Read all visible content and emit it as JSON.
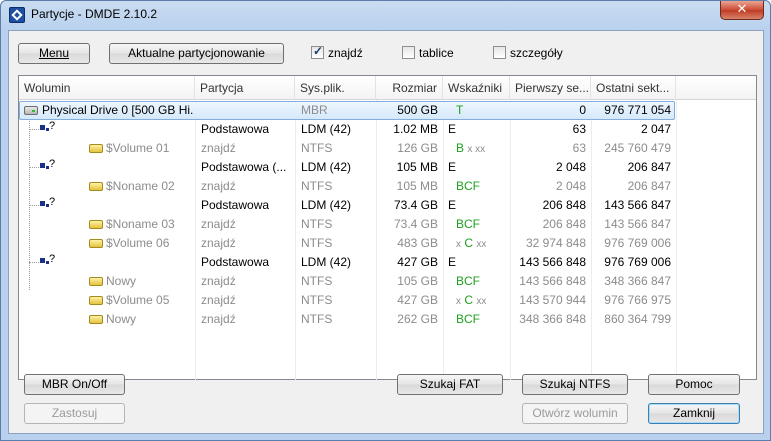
{
  "window": {
    "title": "Partycje - DMDE 2.10.2",
    "close_label": "✕"
  },
  "toolbar": {
    "menu_label": "Menu",
    "current_label": "Aktualne partycjonowanie",
    "chk_znajdz": {
      "label": "znajdź",
      "checked": true
    },
    "chk_tablice": {
      "label": "tablice",
      "checked": false
    },
    "chk_szczegoly": {
      "label": "szczegóły",
      "checked": false
    }
  },
  "columns": [
    "Wolumin",
    "Partycja",
    "Sys.plik.",
    "Rozmiar",
    "Wskaźniki",
    "Pierwszy se...",
    "Ostatni sekt..."
  ],
  "rows": [
    {
      "name": "Physical Drive 0 [500 GB Hi...",
      "part": "",
      "fs": "MBR",
      "size": "500 GB",
      "flags": "T",
      "first": "0",
      "last": "976 771 054"
    },
    {
      "name": "?",
      "part": "Podstawowa",
      "fs": "LDM (42)",
      "size": "1.02 MB",
      "flags": "E",
      "first": "63",
      "last": "2 047"
    },
    {
      "name": "$Volume 01",
      "part": "znajdź",
      "fs": "NTFS",
      "size": "126 GB",
      "flags": "B",
      "flags_extra": "x xx",
      "first": "63",
      "last": "245 760 479"
    },
    {
      "name": "?",
      "part": "Podstawowa (...",
      "fs": "LDM (42)",
      "size": "105 MB",
      "flags": "E",
      "first": "2 048",
      "last": "206 847"
    },
    {
      "name": "$Noname 02",
      "part": "znajdź",
      "fs": "NTFS",
      "size": "105 MB",
      "flags": "BCF",
      "first": "2 048",
      "last": "206 847"
    },
    {
      "name": "?",
      "part": "Podstawowa",
      "fs": "LDM (42)",
      "size": "73.4 GB",
      "flags": "E",
      "first": "206 848",
      "last": "143 566 847"
    },
    {
      "name": "$Noname 03",
      "part": "znajdź",
      "fs": "NTFS",
      "size": "73.4 GB",
      "flags": "BCF",
      "first": "206 848",
      "last": "143 566 847"
    },
    {
      "name": "$Volume 06",
      "part": "znajdź",
      "fs": "NTFS",
      "size": "483 GB",
      "flags_pre": "x",
      "flags": "C",
      "flags_extra": "xx",
      "first": "32 974 848",
      "last": "976 769 006"
    },
    {
      "name": "?",
      "part": "Podstawowa",
      "fs": "LDM (42)",
      "size": "427 GB",
      "flags": "E",
      "first": "143 566 848",
      "last": "976 769 006"
    },
    {
      "name": "Nowy",
      "part": "znajdź",
      "fs": "NTFS",
      "size": "105 GB",
      "flags": "BCF",
      "first": "143 566 848",
      "last": "348 366 847"
    },
    {
      "name": "$Volume 05",
      "part": "znajdź",
      "fs": "NTFS",
      "size": "427 GB",
      "flags_pre": "x",
      "flags": "C",
      "flags_extra": "xx",
      "first": "143 570 944",
      "last": "976 766 975"
    },
    {
      "name": "Nowy",
      "part": "znajdź",
      "fs": "NTFS",
      "size": "262 GB",
      "flags": "BCF",
      "first": "348 366 848",
      "last": "860 364 799"
    }
  ],
  "buttons": {
    "mbr": "MBR On/Off",
    "apply": "Zastosuj",
    "fat": "Szukaj FAT",
    "ntfs": "Szukaj NTFS",
    "help": "Pomoc",
    "open": "Otwórz wolumin",
    "close": "Zamknij"
  },
  "colors": {
    "flags_green": "#1fa01f",
    "selection": "#d5e9fb",
    "gray_text": "#8c8c8c"
  }
}
